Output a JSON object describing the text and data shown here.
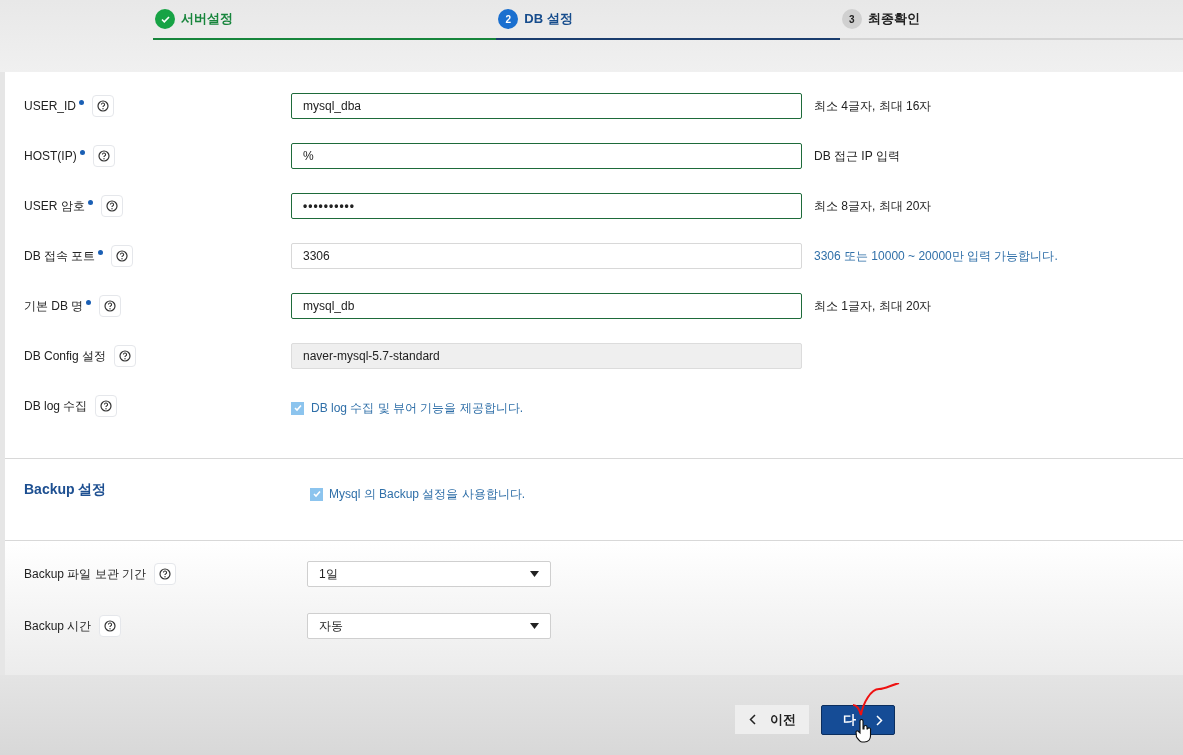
{
  "steps": [
    {
      "label": "서버설정",
      "kind": "done"
    },
    {
      "number": "2",
      "label": "DB 설정",
      "kind": "current"
    },
    {
      "number": "3",
      "label": "최종확인",
      "kind": "upcoming"
    }
  ],
  "fields": [
    {
      "kind": "text",
      "label": "USER_ID",
      "required": true,
      "value": "mysql_dba",
      "valid": true,
      "hint": "최소 4글자, 최대 16자",
      "hint_info": false
    },
    {
      "kind": "text",
      "label": "HOST(IP)",
      "required": true,
      "value": "%",
      "valid": true,
      "hint": "DB 접근 IP 입력",
      "hint_info": false
    },
    {
      "kind": "password",
      "label": "USER 암호",
      "required": true,
      "value": "••••••••••",
      "valid": true,
      "hint": "최소 8글자, 최대 20자",
      "hint_info": false
    },
    {
      "kind": "text",
      "label": "DB 접속 포트",
      "required": true,
      "value": "3306",
      "valid": false,
      "hint": "3306 또는 10000 ~ 20000만 입력 가능합니다.",
      "hint_info": true
    },
    {
      "kind": "text",
      "label": "기본 DB 명",
      "required": true,
      "value": "mysql_db",
      "valid": true,
      "hint": "최소 1글자, 최대 20자",
      "hint_info": false
    },
    {
      "kind": "readonly",
      "label": "DB Config 설정",
      "required": false,
      "value": "naver-mysql-5.7-standard"
    },
    {
      "kind": "checkbox",
      "label": "DB log 수집",
      "required": false,
      "checked": true,
      "value": "DB log 수집 및 뷰어 기능을 제공합니다."
    }
  ],
  "backup": {
    "title": "Backup 설정",
    "checkbox": {
      "label": "Mysql 의 Backup 설정을 사용합니다.",
      "checked": true
    },
    "settings": [
      {
        "label": "Backup 파일 보관 기간",
        "value": "1일"
      },
      {
        "label": "Backup 시간",
        "value": "자동"
      }
    ]
  },
  "buttons": {
    "prev": "이전",
    "next": "다"
  }
}
